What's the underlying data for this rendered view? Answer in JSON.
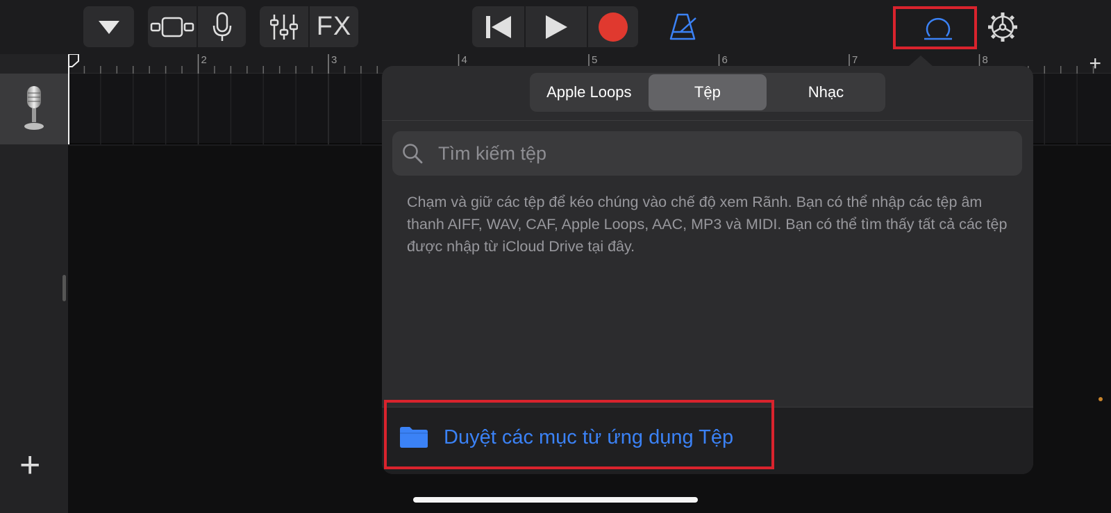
{
  "toolbar": {
    "fx_label": "FX"
  },
  "ruler": {
    "bars": [
      "2",
      "3",
      "4",
      "5",
      "6",
      "7",
      "8"
    ]
  },
  "segmented": {
    "tabs": [
      "Apple Loops",
      "Tệp",
      "Nhạc"
    ],
    "selected": "Tệp"
  },
  "search": {
    "placeholder": "Tìm kiếm tệp"
  },
  "info": {
    "text": "Chạm và giữ các tệp để kéo chúng vào chế độ xem Rãnh. Bạn có thể nhập các tệp âm thanh AIFF, WAV, CAF, Apple Loops, AAC, MP3 và MIDI. Bạn có thể tìm thấy tất cả các tệp được nhập từ iCloud Drive tại đây."
  },
  "browse": {
    "label": "Duyệt các mục từ ứng dụng Tệp"
  },
  "icons": {
    "loop_browser": "loop-icon",
    "settings": "gear-icon",
    "folder": "folder-icon"
  },
  "colors": {
    "accent": "#3b82f6",
    "record": "#e0392f",
    "highlight": "#d9232d"
  }
}
